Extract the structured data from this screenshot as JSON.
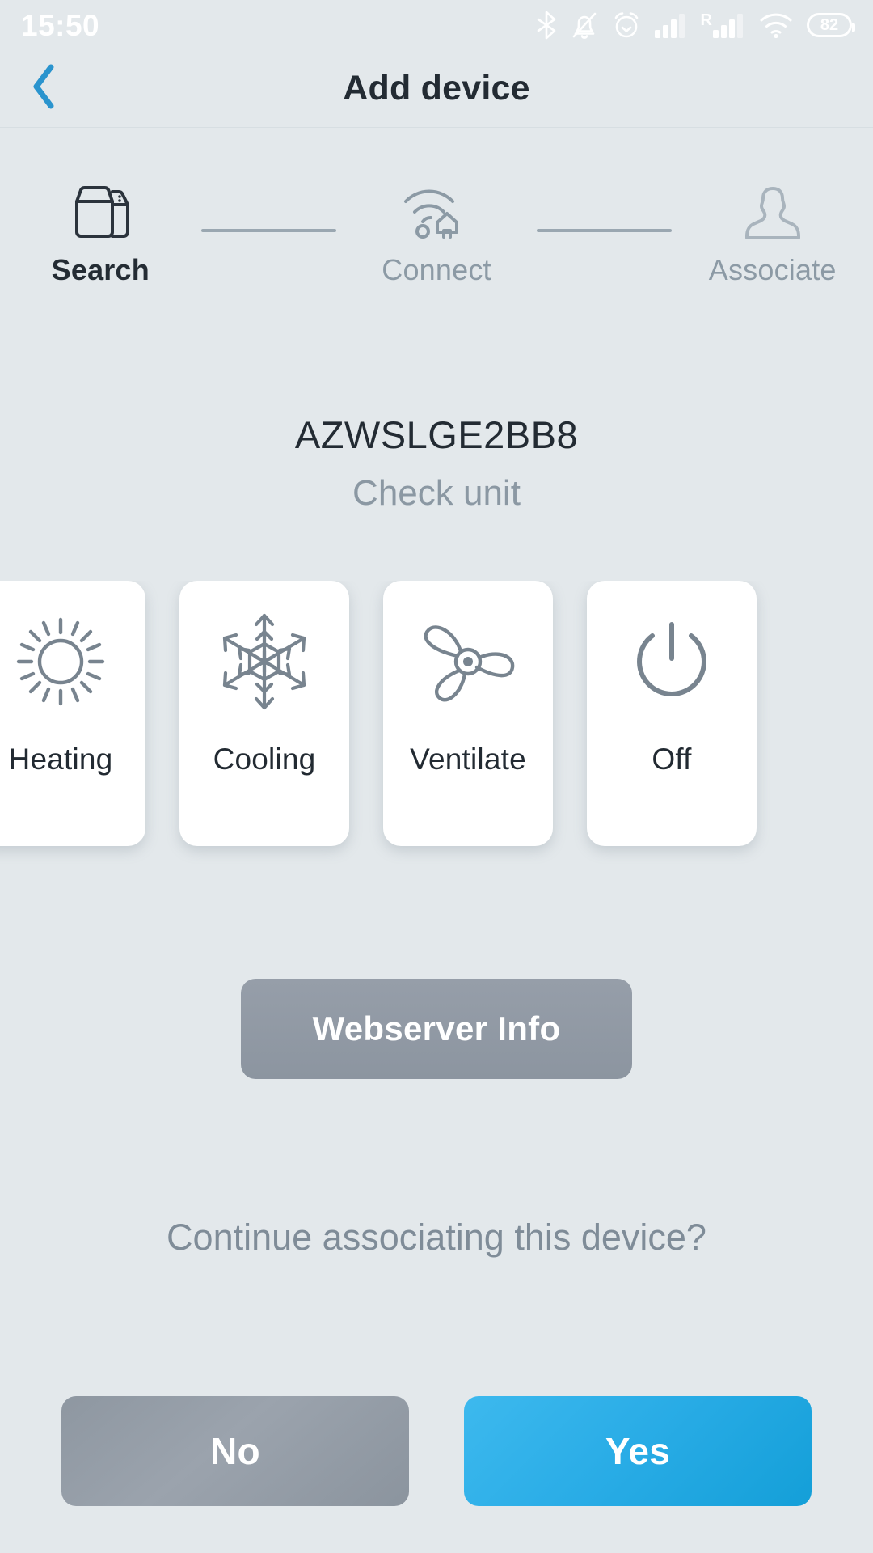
{
  "statusbar": {
    "time": "15:50",
    "battery_level": "82",
    "roaming_label": "R",
    "icons": [
      "bluetooth-icon",
      "bell-muted-icon",
      "alarm-clock-icon",
      "cellular-signal-icon",
      "roaming-signal-icon",
      "wifi-icon",
      "battery-icon"
    ]
  },
  "header": {
    "title": "Add device",
    "back_icon": "chevron-left-icon"
  },
  "stepper": {
    "steps": [
      {
        "label": "Search",
        "icon": "box-archive-icon",
        "state": "active"
      },
      {
        "label": "Connect",
        "icon": "wifi-home-icon",
        "state": "idle"
      },
      {
        "label": "Associate",
        "icon": "person-icon",
        "state": "idle"
      }
    ]
  },
  "device": {
    "name": "AZWSLGE2BB8",
    "subtitle": "Check unit"
  },
  "modes": [
    {
      "label": "Heating",
      "icon": "sun-icon"
    },
    {
      "label": "Cooling",
      "icon": "snowflake-icon"
    },
    {
      "label": "Ventilate",
      "icon": "fan-icon"
    },
    {
      "label": "Off",
      "icon": "power-icon"
    }
  ],
  "webserver": {
    "label": "Webserver Info"
  },
  "prompt": {
    "question": "Continue associating this device?"
  },
  "actions": {
    "no_label": "No",
    "yes_label": "Yes"
  },
  "colors": {
    "background": "#e3e8eb",
    "accent_blue": "#2a9fd6",
    "text_dark": "#232b33",
    "text_muted": "#8b98a3",
    "card_white": "#ffffff",
    "slate_button": "#8f98a3"
  }
}
